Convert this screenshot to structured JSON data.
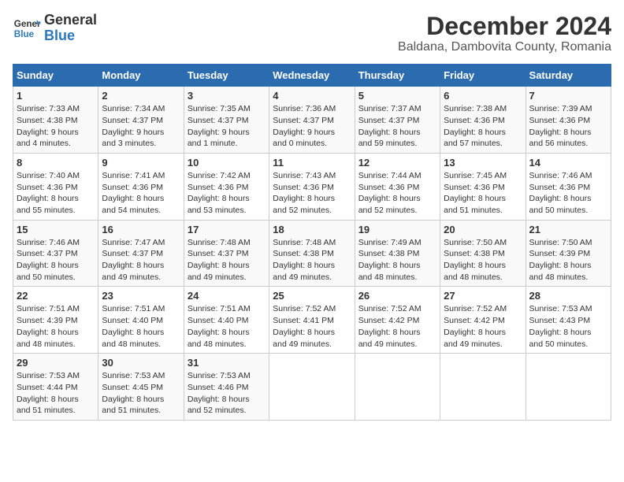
{
  "logo": {
    "line1": "General",
    "line2": "Blue"
  },
  "title": "December 2024",
  "subtitle": "Baldana, Dambovita County, Romania",
  "days_of_week": [
    "Sunday",
    "Monday",
    "Tuesday",
    "Wednesday",
    "Thursday",
    "Friday",
    "Saturday"
  ],
  "weeks": [
    [
      {
        "day": 1,
        "info": "Sunrise: 7:33 AM\nSunset: 4:38 PM\nDaylight: 9 hours\nand 4 minutes."
      },
      {
        "day": 2,
        "info": "Sunrise: 7:34 AM\nSunset: 4:37 PM\nDaylight: 9 hours\nand 3 minutes."
      },
      {
        "day": 3,
        "info": "Sunrise: 7:35 AM\nSunset: 4:37 PM\nDaylight: 9 hours\nand 1 minute."
      },
      {
        "day": 4,
        "info": "Sunrise: 7:36 AM\nSunset: 4:37 PM\nDaylight: 9 hours\nand 0 minutes."
      },
      {
        "day": 5,
        "info": "Sunrise: 7:37 AM\nSunset: 4:37 PM\nDaylight: 8 hours\nand 59 minutes."
      },
      {
        "day": 6,
        "info": "Sunrise: 7:38 AM\nSunset: 4:36 PM\nDaylight: 8 hours\nand 57 minutes."
      },
      {
        "day": 7,
        "info": "Sunrise: 7:39 AM\nSunset: 4:36 PM\nDaylight: 8 hours\nand 56 minutes."
      }
    ],
    [
      {
        "day": 8,
        "info": "Sunrise: 7:40 AM\nSunset: 4:36 PM\nDaylight: 8 hours\nand 55 minutes."
      },
      {
        "day": 9,
        "info": "Sunrise: 7:41 AM\nSunset: 4:36 PM\nDaylight: 8 hours\nand 54 minutes."
      },
      {
        "day": 10,
        "info": "Sunrise: 7:42 AM\nSunset: 4:36 PM\nDaylight: 8 hours\nand 53 minutes."
      },
      {
        "day": 11,
        "info": "Sunrise: 7:43 AM\nSunset: 4:36 PM\nDaylight: 8 hours\nand 52 minutes."
      },
      {
        "day": 12,
        "info": "Sunrise: 7:44 AM\nSunset: 4:36 PM\nDaylight: 8 hours\nand 52 minutes."
      },
      {
        "day": 13,
        "info": "Sunrise: 7:45 AM\nSunset: 4:36 PM\nDaylight: 8 hours\nand 51 minutes."
      },
      {
        "day": 14,
        "info": "Sunrise: 7:46 AM\nSunset: 4:36 PM\nDaylight: 8 hours\nand 50 minutes."
      }
    ],
    [
      {
        "day": 15,
        "info": "Sunrise: 7:46 AM\nSunset: 4:37 PM\nDaylight: 8 hours\nand 50 minutes."
      },
      {
        "day": 16,
        "info": "Sunrise: 7:47 AM\nSunset: 4:37 PM\nDaylight: 8 hours\nand 49 minutes."
      },
      {
        "day": 17,
        "info": "Sunrise: 7:48 AM\nSunset: 4:37 PM\nDaylight: 8 hours\nand 49 minutes."
      },
      {
        "day": 18,
        "info": "Sunrise: 7:48 AM\nSunset: 4:38 PM\nDaylight: 8 hours\nand 49 minutes."
      },
      {
        "day": 19,
        "info": "Sunrise: 7:49 AM\nSunset: 4:38 PM\nDaylight: 8 hours\nand 48 minutes."
      },
      {
        "day": 20,
        "info": "Sunrise: 7:50 AM\nSunset: 4:38 PM\nDaylight: 8 hours\nand 48 minutes."
      },
      {
        "day": 21,
        "info": "Sunrise: 7:50 AM\nSunset: 4:39 PM\nDaylight: 8 hours\nand 48 minutes."
      }
    ],
    [
      {
        "day": 22,
        "info": "Sunrise: 7:51 AM\nSunset: 4:39 PM\nDaylight: 8 hours\nand 48 minutes."
      },
      {
        "day": 23,
        "info": "Sunrise: 7:51 AM\nSunset: 4:40 PM\nDaylight: 8 hours\nand 48 minutes."
      },
      {
        "day": 24,
        "info": "Sunrise: 7:51 AM\nSunset: 4:40 PM\nDaylight: 8 hours\nand 48 minutes."
      },
      {
        "day": 25,
        "info": "Sunrise: 7:52 AM\nSunset: 4:41 PM\nDaylight: 8 hours\nand 49 minutes."
      },
      {
        "day": 26,
        "info": "Sunrise: 7:52 AM\nSunset: 4:42 PM\nDaylight: 8 hours\nand 49 minutes."
      },
      {
        "day": 27,
        "info": "Sunrise: 7:52 AM\nSunset: 4:42 PM\nDaylight: 8 hours\nand 49 minutes."
      },
      {
        "day": 28,
        "info": "Sunrise: 7:53 AM\nSunset: 4:43 PM\nDaylight: 8 hours\nand 50 minutes."
      }
    ],
    [
      {
        "day": 29,
        "info": "Sunrise: 7:53 AM\nSunset: 4:44 PM\nDaylight: 8 hours\nand 51 minutes."
      },
      {
        "day": 30,
        "info": "Sunrise: 7:53 AM\nSunset: 4:45 PM\nDaylight: 8 hours\nand 51 minutes."
      },
      {
        "day": 31,
        "info": "Sunrise: 7:53 AM\nSunset: 4:46 PM\nDaylight: 8 hours\nand 52 minutes."
      },
      null,
      null,
      null,
      null
    ]
  ]
}
